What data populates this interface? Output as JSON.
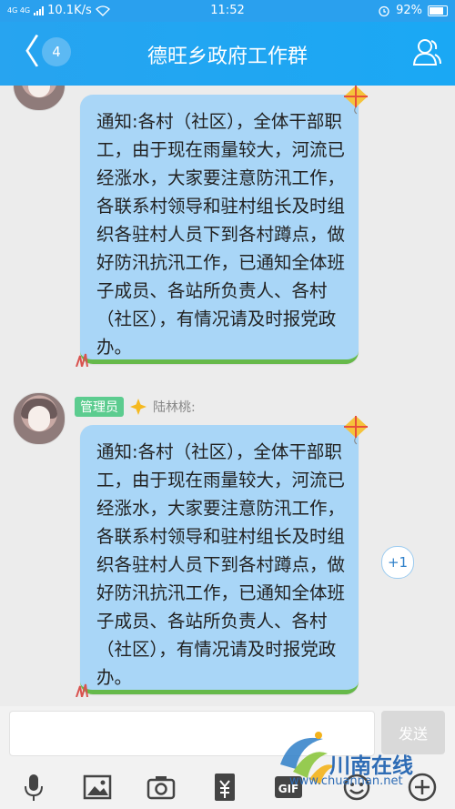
{
  "status": {
    "network": "4G 4G",
    "speed": "10.1K/s",
    "time": "11:52",
    "battery": "92%"
  },
  "header": {
    "back_count": "4",
    "title": "德旺乡政府工作群"
  },
  "messages": [
    {
      "text": "通知:各村（社区），全体干部职工，由于现在雨量较大，河流已经涨水，大家要注意防汛工作，各联系村领导和驻村组长及时组织各驻村人员下到各村蹲点，做好防汛抗汛工作，已通知全体班子成员、各站所负责人、各村（社区），有情况请及时报党政办。"
    },
    {
      "role": "管理员",
      "sender": "陆林桃:",
      "text": "通知:各村（社区），全体干部职工，由于现在雨量较大，河流已经涨水，大家要注意防汛工作，各联系村领导和驻村组长及时组织各驻村人员下到各村蹲点，做好防汛抗汛工作，已通知全体班子成员、各站所负责人、各村（社区），有情况请及时报党政办。",
      "plus_one": "+1"
    }
  ],
  "input": {
    "send_label": "发送",
    "tools": [
      "mic-icon",
      "image-icon",
      "camera-icon",
      "red-packet-icon",
      "gif-icon",
      "emoji-icon",
      "plus-icon"
    ],
    "gif_label": "GIF"
  },
  "watermark": {
    "name": "川南在线",
    "url": "www.chuannan.net"
  },
  "colors": {
    "header": "#27a4f0",
    "bubble": "#a9d6f7",
    "bubble_bottom": "#66b94a",
    "admin_badge": "#5ccc8f"
  }
}
